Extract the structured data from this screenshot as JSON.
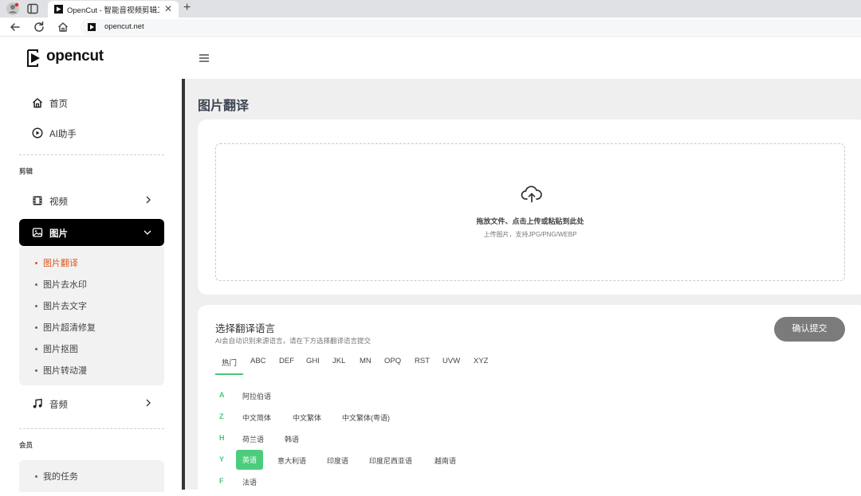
{
  "browser": {
    "tab_title": "OpenCut - 智能音视频剪辑工具",
    "tab_close": "✕",
    "new_tab": "+",
    "url": "opencut.net"
  },
  "logo": {
    "text": "opencut"
  },
  "sidebar": {
    "top_items": [
      {
        "label": "首页",
        "icon": "home-icon"
      },
      {
        "label": "AI助手",
        "icon": "play-circle-icon"
      }
    ],
    "section_edit": "剪辑",
    "video": {
      "label": "视频",
      "icon": "film-icon"
    },
    "image": {
      "label": "图片",
      "icon": "image-icon",
      "expanded": true
    },
    "image_sub": [
      {
        "label": "图片翻译",
        "active": true
      },
      {
        "label": "图片去水印"
      },
      {
        "label": "图片去文字"
      },
      {
        "label": "图片超清修复"
      },
      {
        "label": "图片抠图"
      },
      {
        "label": "图片转动漫"
      }
    ],
    "audio": {
      "label": "音频",
      "icon": "music-icon"
    },
    "section_member": "会员",
    "member_items": [
      {
        "label": "我的任务"
      }
    ]
  },
  "main": {
    "page_title": "图片翻译",
    "upload": {
      "main_text": "拖放文件、点击上传或粘贴到此处",
      "sub_text": "上传图片，支持JPG/PNG/WEBP"
    },
    "lang": {
      "title": "选择翻译语言",
      "desc": "AI会自动识别来源语言，请在下方选择翻译语言提交",
      "submit": "确认提交",
      "tabs": [
        "热门",
        "ABC",
        "DEF",
        "GHI",
        "JKL",
        "MN",
        "OPQ",
        "RST",
        "UVW",
        "XYZ"
      ],
      "active_tab": "热门",
      "groups": [
        {
          "letter": "A",
          "langs": [
            "阿拉伯语"
          ]
        },
        {
          "letter": "Z",
          "langs": [
            "中文简体",
            "中文繁体",
            "中文繁体(粤语)"
          ]
        },
        {
          "letter": "H",
          "langs": [
            "荷兰语",
            "韩语"
          ]
        },
        {
          "letter": "Y",
          "langs": [
            "英语",
            "意大利语",
            "印度语",
            "印度尼西亚语",
            "越南语"
          ]
        },
        {
          "letter": "F",
          "langs": [
            "法语"
          ]
        }
      ],
      "selected": "英语"
    }
  },
  "colors": {
    "accent_green": "#49c77a",
    "active_orange": "#e2541c",
    "active_menu_bg": "#000000",
    "submit_bg": "#7b7b7b"
  }
}
